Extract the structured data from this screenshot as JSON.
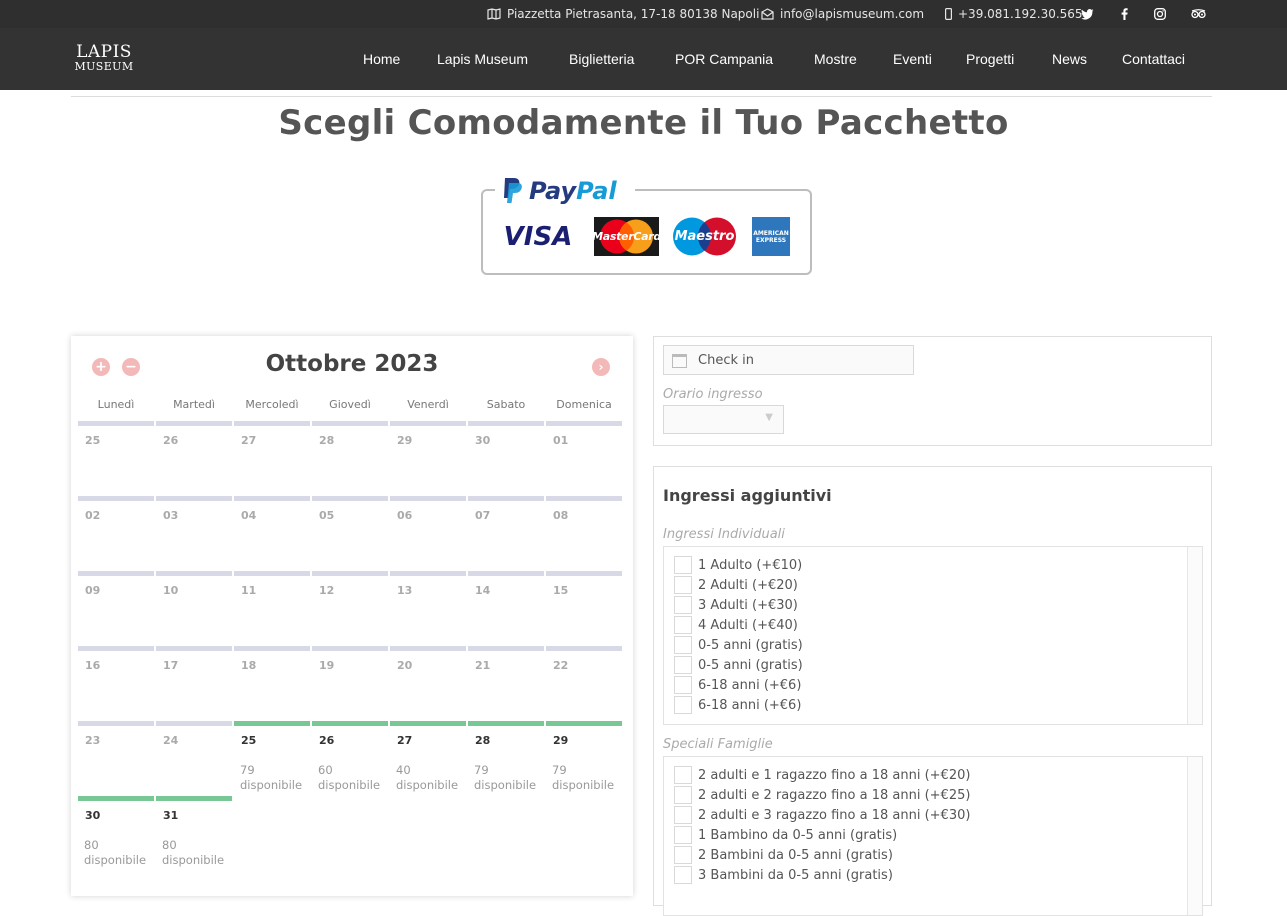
{
  "topbar": {
    "address": "Piazzetta Pietrasanta, 17-18 80138 Napoli",
    "email": "info@lapismuseum.com",
    "phone": "+39.081.192.30.565",
    "social_icons": [
      "twitter-icon",
      "facebook-icon",
      "instagram-icon",
      "tripadvisor-icon"
    ]
  },
  "logo": {
    "line1": "LAPIS",
    "line2": "MUSEUM"
  },
  "nav": {
    "items": [
      "Home",
      "Lapis Museum",
      "Biglietteria",
      "POR Campania",
      "Mostre",
      "Eventi",
      "Progetti",
      "News",
      "Contattaci"
    ]
  },
  "page_title": "Scegli Comodamente il Tuo Pacchetto",
  "payment": {
    "paypal": [
      "Pay",
      "Pal"
    ],
    "cards": [
      "VISA",
      "MasterCard",
      "Maestro",
      "AMERICAN EXPRESS"
    ],
    "colors": {
      "paypal_dark": "#253b80",
      "paypal_light": "#179bd7",
      "visa": "#1a1f71",
      "mastercard": "#eb001b",
      "maestro": "#0099df",
      "amex": "#2e77bc"
    }
  },
  "calendar": {
    "title": "Ottobre 2023",
    "weekdays": [
      "Lunedì",
      "Martedì",
      "Mercoledì",
      "Giovedì",
      "Venerdì",
      "Sabato",
      "Domenica"
    ],
    "weeks": [
      [
        {
          "d": "25"
        },
        {
          "d": "26"
        },
        {
          "d": "27"
        },
        {
          "d": "28"
        },
        {
          "d": "29"
        },
        {
          "d": "30"
        },
        {
          "d": "01"
        }
      ],
      [
        {
          "d": "02"
        },
        {
          "d": "03"
        },
        {
          "d": "04"
        },
        {
          "d": "05"
        },
        {
          "d": "06"
        },
        {
          "d": "07"
        },
        {
          "d": "08"
        }
      ],
      [
        {
          "d": "09"
        },
        {
          "d": "10"
        },
        {
          "d": "11"
        },
        {
          "d": "12"
        },
        {
          "d": "13"
        },
        {
          "d": "14"
        },
        {
          "d": "15"
        }
      ],
      [
        {
          "d": "16"
        },
        {
          "d": "17"
        },
        {
          "d": "18"
        },
        {
          "d": "19"
        },
        {
          "d": "20"
        },
        {
          "d": "21"
        },
        {
          "d": "22"
        }
      ],
      [
        {
          "d": "23"
        },
        {
          "d": "24"
        },
        {
          "d": "25",
          "n": "79",
          "a": "disponibile"
        },
        {
          "d": "26",
          "n": "60",
          "a": "disponibile"
        },
        {
          "d": "27",
          "n": "40",
          "a": "disponibile"
        },
        {
          "d": "28",
          "n": "79",
          "a": "disponibile"
        },
        {
          "d": "29",
          "n": "79",
          "a": "disponibile"
        }
      ],
      [
        {
          "d": "30",
          "n": "80",
          "a": "disponibile"
        },
        {
          "d": "31",
          "n": "80",
          "a": "disponibile"
        }
      ]
    ],
    "colors": {
      "available": "#78c896",
      "unavailable": "#d8d9e6",
      "nav_button": "#f3b8b8"
    }
  },
  "booking": {
    "checkin_placeholder": "Check in",
    "orario_label": "Orario ingresso",
    "orario_value": "",
    "extra_title": "Ingressi aggiuntivi",
    "individual_label": "Ingressi Individuali",
    "individual_options": [
      "1 Adulto (+€10)",
      "2 Adulti (+€20)",
      "3 Adulti (+€30)",
      "4 Adulti (+€40)",
      "0-5 anni (gratis)",
      "0-5 anni (gratis)",
      "6-18 anni (+€6)",
      "6-18 anni (+€6)"
    ],
    "family_label": "Speciali Famiglie",
    "family_options": [
      "2 adulti e 1 ragazzo fino a 18 anni (+€20)",
      "2 adulti e 2 ragazzo fino a 18 anni (+€25)",
      "2 adulti e 3 ragazzo fino a 18 anni (+€30)",
      "1 Bambino da 0-5 anni (gratis)",
      "2 Bambini da 0-5 anni (gratis)",
      "3 Bambini da 0-5 anni (gratis)"
    ]
  }
}
